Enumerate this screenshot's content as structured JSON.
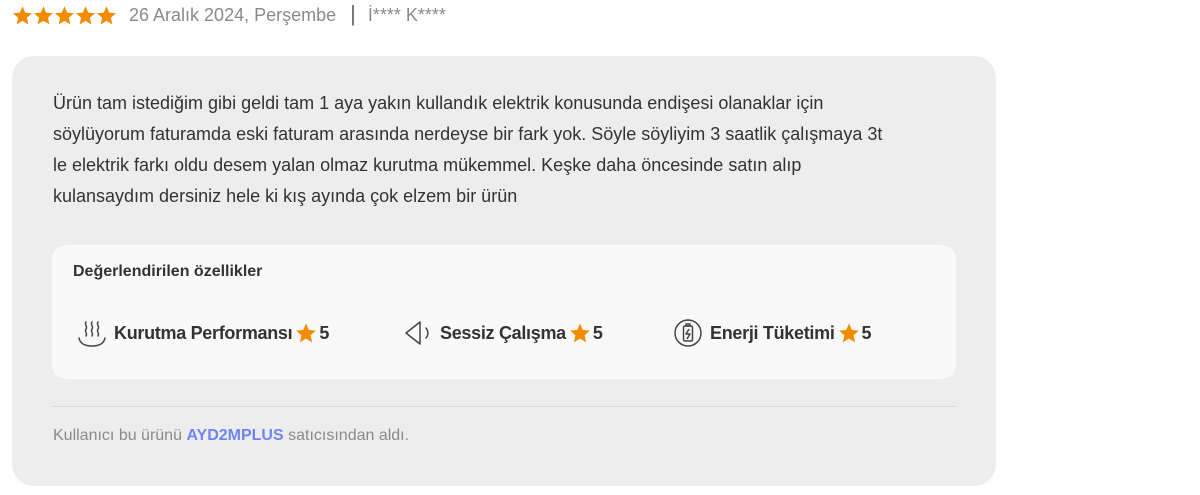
{
  "review": {
    "rating": 5,
    "date": "26 Aralık 2024, Perşembe",
    "separator": "|",
    "user": "İ**** K****",
    "comment": "Ürün tam istediğim gibi geldi tam 1 aya yakın kullandık elektrik konusunda endişesi olanaklar için\nsöylüyorum faturamda eski faturam arasında nerdeyse bir fark yok. Söyle söyliyim 3 saatlik çalışmaya 3t\nle elektrik farkı oldu desem yalan olmaz kurutma mükemmel. Keşke daha öncesinde satın alıp\nkulansaydım dersiniz hele ki kış ayında çok elzem bir ürün"
  },
  "features": {
    "title": "Değerlendirilen özellikler",
    "items": [
      {
        "icon": "heat-waves-icon",
        "label": "Kurutma Performansı",
        "score": "5"
      },
      {
        "icon": "speaker-sound-icon",
        "label": "Sessiz Çalışma",
        "score": "5"
      },
      {
        "icon": "battery-energy-icon",
        "label": "Enerji Tüketimi",
        "score": "5"
      }
    ]
  },
  "seller": {
    "prefix": "Kullanıcı bu ürünü",
    "name": "AYD2MPLUS",
    "suffix": "satıcısından aldı."
  },
  "colors": {
    "star": "#f28b00",
    "seller_link": "#6f86f2",
    "card_bg": "#ededed",
    "features_bg": "#f9f9f9"
  }
}
